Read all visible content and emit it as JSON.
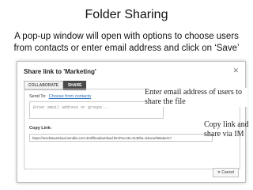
{
  "slide": {
    "title": "Folder Sharing",
    "caption": "A pop-up window will open with options to choose users from contacts or enter email address and click on ‘Save’"
  },
  "dialog": {
    "title": "Share link to 'Marketing'",
    "tabs": [
      {
        "label": "COLLABORATE",
        "active": false
      },
      {
        "label": "SHARE",
        "active": true
      }
    ],
    "send_to_label": "Send To:",
    "choose_contacts_link": "Choose from contacts",
    "email_placeholder": "Enter email address or groups...",
    "copy_link_label": "Copy Link:",
    "link_url": "https://sendsteastcloud.sendbu.com:443/fileadownload.html?accID=3138ha=04acuef60a6e417",
    "cancel_label": "Cancel",
    "close_icon": "close-icon"
  },
  "annotations": {
    "email_note": "Enter email address of users to share the file",
    "copy_note": "Copy link and share via IM"
  }
}
